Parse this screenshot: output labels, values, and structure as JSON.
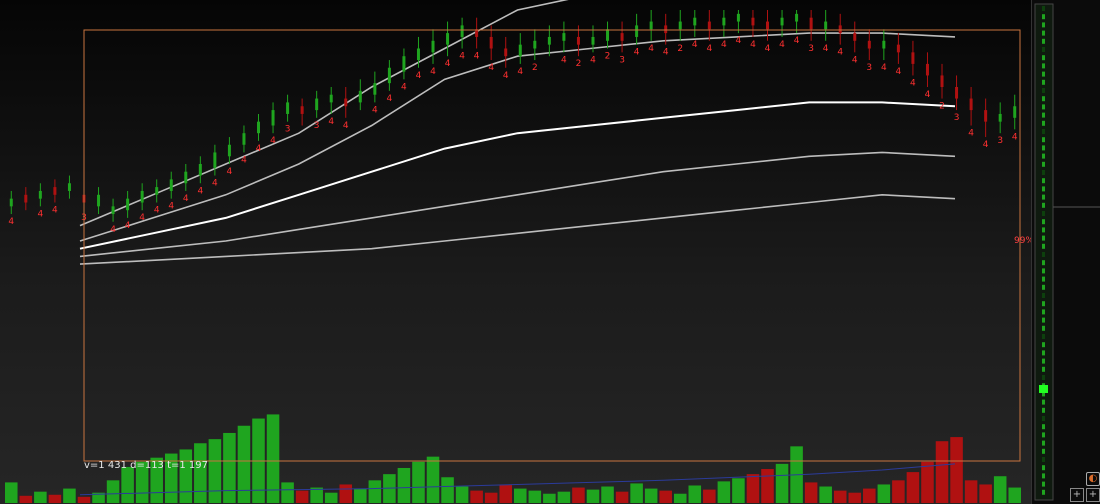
{
  "colors": {
    "up": "#1fa51f",
    "down": "#b01111",
    "frame": "#c8743f",
    "band": "#bdbdbd",
    "center": "#ffffff",
    "avg": "#2b3b9a",
    "count": "#ff3030"
  },
  "stats_text": "v=1 431 d=113 t=1 197",
  "percent_label": "99%",
  "icons": [
    "tag-icon",
    "grid-icon"
  ],
  "chart_data": {
    "type": "candlestick-with-volume",
    "title": "",
    "grid": false,
    "price_range": [
      0,
      100
    ],
    "volume_range": [
      0,
      100
    ],
    "bars": [
      {
        "o": 49,
        "c": 51,
        "l": 47,
        "h": 53,
        "v": 20,
        "n": "4"
      },
      {
        "o": 52,
        "c": 50,
        "l": 48,
        "h": 54,
        "v": 7,
        "n": ""
      },
      {
        "o": 51,
        "c": 53,
        "l": 49,
        "h": 55,
        "v": 11,
        "n": "4"
      },
      {
        "o": 54,
        "c": 52,
        "l": 50,
        "h": 56,
        "v": 8,
        "n": "4"
      },
      {
        "o": 53,
        "c": 55,
        "l": 51,
        "h": 57,
        "v": 14,
        "n": ""
      },
      {
        "o": 52,
        "c": 50,
        "l": 48,
        "h": 54,
        "v": 6,
        "n": "3"
      },
      {
        "o": 49,
        "c": 52,
        "l": 47,
        "h": 54,
        "v": 10,
        "n": ""
      },
      {
        "o": 47,
        "c": 49,
        "l": 45,
        "h": 51,
        "v": 22,
        "n": "4"
      },
      {
        "o": 48,
        "c": 51,
        "l": 46,
        "h": 53,
        "v": 35,
        "n": "4"
      },
      {
        "o": 50,
        "c": 53,
        "l": 48,
        "h": 55,
        "v": 40,
        "n": "4"
      },
      {
        "o": 52,
        "c": 54,
        "l": 50,
        "h": 56,
        "v": 44,
        "n": "4"
      },
      {
        "o": 53,
        "c": 56,
        "l": 51,
        "h": 58,
        "v": 48,
        "n": "4"
      },
      {
        "o": 55,
        "c": 58,
        "l": 53,
        "h": 60,
        "v": 52,
        "n": "4"
      },
      {
        "o": 57,
        "c": 60,
        "l": 55,
        "h": 62,
        "v": 58,
        "n": "4"
      },
      {
        "o": 59,
        "c": 63,
        "l": 57,
        "h": 65,
        "v": 62,
        "n": "4"
      },
      {
        "o": 62,
        "c": 65,
        "l": 60,
        "h": 67,
        "v": 68,
        "n": "4"
      },
      {
        "o": 65,
        "c": 68,
        "l": 63,
        "h": 70,
        "v": 75,
        "n": "4"
      },
      {
        "o": 68,
        "c": 71,
        "l": 66,
        "h": 73,
        "v": 82,
        "n": "4"
      },
      {
        "o": 70,
        "c": 74,
        "l": 68,
        "h": 76,
        "v": 86,
        "n": "4"
      },
      {
        "o": 73,
        "c": 76,
        "l": 71,
        "h": 78,
        "v": 20,
        "n": "3"
      },
      {
        "o": 75,
        "c": 73,
        "l": 70,
        "h": 77,
        "v": 12,
        "n": ""
      },
      {
        "o": 74,
        "c": 77,
        "l": 72,
        "h": 79,
        "v": 15,
        "n": "3"
      },
      {
        "o": 76,
        "c": 78,
        "l": 73,
        "h": 80,
        "v": 10,
        "n": "4"
      },
      {
        "o": 77,
        "c": 75,
        "l": 72,
        "h": 80,
        "v": 18,
        "n": "4"
      },
      {
        "o": 76,
        "c": 79,
        "l": 74,
        "h": 82,
        "v": 14,
        "n": ""
      },
      {
        "o": 78,
        "c": 81,
        "l": 76,
        "h": 84,
        "v": 22,
        "n": "4"
      },
      {
        "o": 81,
        "c": 85,
        "l": 79,
        "h": 87,
        "v": 28,
        "n": "4"
      },
      {
        "o": 84,
        "c": 88,
        "l": 82,
        "h": 90,
        "v": 34,
        "n": "4"
      },
      {
        "o": 87,
        "c": 90,
        "l": 85,
        "h": 93,
        "v": 40,
        "n": "4"
      },
      {
        "o": 89,
        "c": 92,
        "l": 86,
        "h": 95,
        "v": 45,
        "n": "4"
      },
      {
        "o": 91,
        "c": 94,
        "l": 88,
        "h": 97,
        "v": 25,
        "n": "4"
      },
      {
        "o": 93,
        "c": 96,
        "l": 90,
        "h": 98,
        "v": 16,
        "n": "4"
      },
      {
        "o": 95,
        "c": 93,
        "l": 90,
        "h": 98,
        "v": 12,
        "n": "4"
      },
      {
        "o": 93,
        "c": 90,
        "l": 87,
        "h": 96,
        "v": 10,
        "n": "4"
      },
      {
        "o": 90,
        "c": 88,
        "l": 85,
        "h": 93,
        "v": 18,
        "n": "4"
      },
      {
        "o": 88,
        "c": 91,
        "l": 86,
        "h": 94,
        "v": 14,
        "n": "4"
      },
      {
        "o": 90,
        "c": 92,
        "l": 87,
        "h": 95,
        "v": 12,
        "n": "2"
      },
      {
        "o": 91,
        "c": 93,
        "l": 88,
        "h": 96,
        "v": 9,
        "n": ""
      },
      {
        "o": 92,
        "c": 94,
        "l": 89,
        "h": 97,
        "v": 11,
        "n": "4"
      },
      {
        "o": 93,
        "c": 91,
        "l": 88,
        "h": 96,
        "v": 15,
        "n": "2"
      },
      {
        "o": 91,
        "c": 93,
        "l": 89,
        "h": 96,
        "v": 13,
        "n": "4"
      },
      {
        "o": 92,
        "c": 95,
        "l": 90,
        "h": 97,
        "v": 16,
        "n": "2"
      },
      {
        "o": 94,
        "c": 92,
        "l": 89,
        "h": 97,
        "v": 11,
        "n": "3"
      },
      {
        "o": 93,
        "c": 96,
        "l": 91,
        "h": 99,
        "v": 19,
        "n": "4"
      },
      {
        "o": 95,
        "c": 97,
        "l": 92,
        "h": 100,
        "v": 14,
        "n": "4"
      },
      {
        "o": 96,
        "c": 94,
        "l": 91,
        "h": 99,
        "v": 12,
        "n": "4"
      },
      {
        "o": 95,
        "c": 97,
        "l": 92,
        "h": 100,
        "v": 9,
        "n": "2"
      },
      {
        "o": 96,
        "c": 98,
        "l": 93,
        "h": 100,
        "v": 17,
        "n": "4"
      },
      {
        "o": 97,
        "c": 95,
        "l": 92,
        "h": 100,
        "v": 13,
        "n": "4"
      },
      {
        "o": 96,
        "c": 98,
        "l": 93,
        "h": 100,
        "v": 21,
        "n": "4"
      },
      {
        "o": 97,
        "c": 99,
        "l": 94,
        "h": 100,
        "v": 24,
        "n": "4"
      },
      {
        "o": 98,
        "c": 96,
        "l": 93,
        "h": 100,
        "v": 28,
        "n": "4"
      },
      {
        "o": 97,
        "c": 95,
        "l": 92,
        "h": 100,
        "v": 33,
        "n": "4"
      },
      {
        "o": 96,
        "c": 98,
        "l": 93,
        "h": 100,
        "v": 38,
        "n": "4"
      },
      {
        "o": 97,
        "c": 99,
        "l": 94,
        "h": 100,
        "v": 55,
        "n": "4"
      },
      {
        "o": 98,
        "c": 95,
        "l": 92,
        "h": 100,
        "v": 20,
        "n": "3"
      },
      {
        "o": 95,
        "c": 97,
        "l": 92,
        "h": 100,
        "v": 16,
        "n": "4"
      },
      {
        "o": 96,
        "c": 94,
        "l": 91,
        "h": 99,
        "v": 12,
        "n": "4"
      },
      {
        "o": 94,
        "c": 92,
        "l": 89,
        "h": 97,
        "v": 10,
        "n": "4"
      },
      {
        "o": 92,
        "c": 90,
        "l": 87,
        "h": 95,
        "v": 14,
        "n": "3"
      },
      {
        "o": 90,
        "c": 92,
        "l": 87,
        "h": 95,
        "v": 18,
        "n": "4"
      },
      {
        "o": 91,
        "c": 89,
        "l": 86,
        "h": 94,
        "v": 22,
        "n": "4"
      },
      {
        "o": 89,
        "c": 86,
        "l": 83,
        "h": 92,
        "v": 30,
        "n": "4"
      },
      {
        "o": 86,
        "c": 83,
        "l": 80,
        "h": 89,
        "v": 40,
        "n": "4"
      },
      {
        "o": 83,
        "c": 80,
        "l": 77,
        "h": 86,
        "v": 60,
        "n": "2"
      },
      {
        "o": 80,
        "c": 77,
        "l": 74,
        "h": 83,
        "v": 64,
        "n": "3"
      },
      {
        "o": 77,
        "c": 74,
        "l": 70,
        "h": 80,
        "v": 22,
        "n": "4"
      },
      {
        "o": 74,
        "c": 71,
        "l": 67,
        "h": 77,
        "v": 18,
        "n": "4"
      },
      {
        "o": 71,
        "c": 73,
        "l": 68,
        "h": 76,
        "v": 26,
        "n": "3"
      },
      {
        "o": 72,
        "c": 75,
        "l": 69,
        "h": 78,
        "v": 15,
        "n": "4"
      }
    ],
    "bands": [
      {
        "role": "upper-2",
        "values": [
          44,
          52,
          60,
          68,
          80,
          90,
          100,
          104,
          106,
          107,
          108,
          108,
          107
        ]
      },
      {
        "role": "upper-1",
        "values": [
          40,
          46,
          52,
          60,
          70,
          82,
          88,
          90,
          92,
          93,
          94,
          94,
          93
        ]
      },
      {
        "role": "center",
        "values": [
          38,
          42,
          46,
          52,
          58,
          64,
          68,
          70,
          72,
          74,
          76,
          76,
          75
        ]
      },
      {
        "role": "lower-1",
        "values": [
          36,
          38,
          40,
          43,
          46,
          49,
          52,
          55,
          58,
          60,
          62,
          63,
          62
        ]
      },
      {
        "role": "lower-2",
        "values": [
          34,
          35,
          36,
          37,
          38,
          40,
          42,
          44,
          46,
          48,
          50,
          52,
          51
        ]
      }
    ],
    "volume_average": [
      8,
      10,
      12,
      13,
      14,
      16,
      18,
      20,
      22,
      25,
      28,
      32,
      38
    ]
  }
}
